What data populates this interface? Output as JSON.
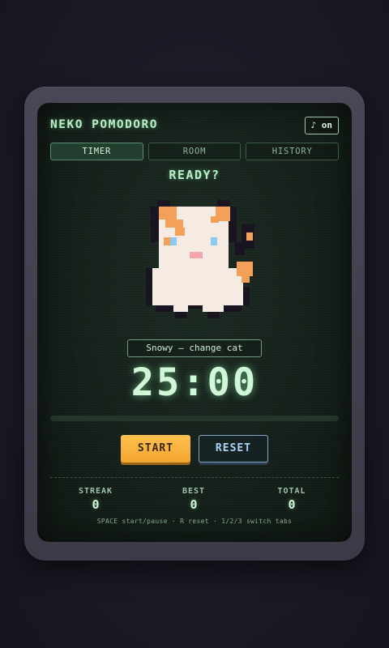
{
  "app": {
    "title": "NEKO POMODORO"
  },
  "sound": {
    "icon": "music-note-icon",
    "label": "♪ on"
  },
  "tabs": [
    {
      "label": "TIMER",
      "active": true
    },
    {
      "label": "ROOM",
      "active": false
    },
    {
      "label": "HISTORY",
      "active": false
    }
  ],
  "status": "READY?",
  "cat": {
    "name_button": "Snowy — change cat"
  },
  "timer": {
    "display": "25:00",
    "progress": 0
  },
  "buttons": {
    "start": "START",
    "reset": "RESET"
  },
  "stats": {
    "streak": {
      "label": "STREAK",
      "value": "0"
    },
    "best": {
      "label": "BEST",
      "value": "0"
    },
    "total": {
      "label": "TOTAL",
      "value": "0"
    }
  },
  "hint": "SPACE start/pause · R reset · 1/2/3 switch tabs",
  "colors": {
    "accent": "#b9f0c8",
    "start": "#f7b23c",
    "reset": "#7fa6c9",
    "screen": "#15201a"
  }
}
